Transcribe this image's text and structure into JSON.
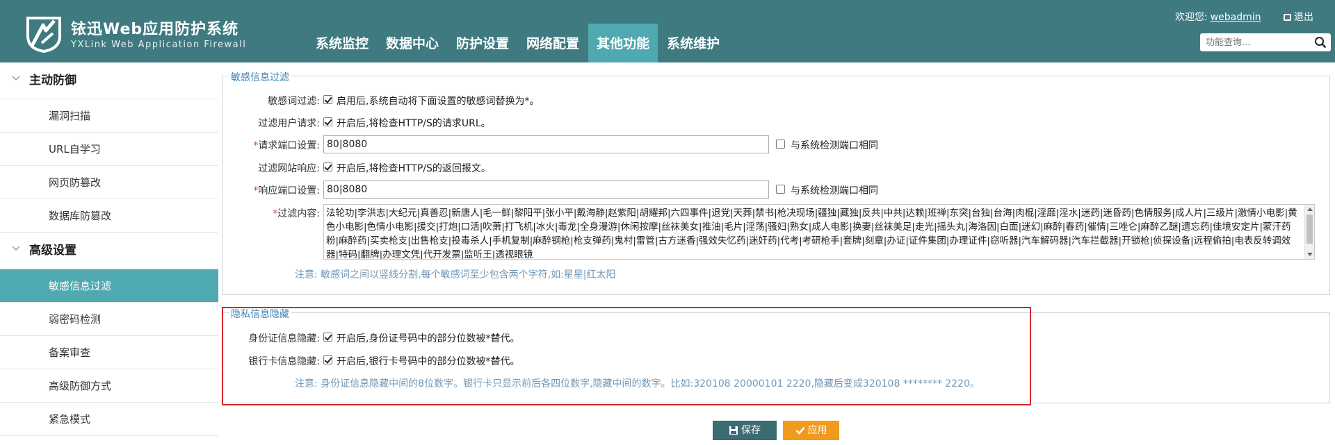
{
  "header": {
    "title": "铱迅Web应用防护系统",
    "subtitle": "YXLink Web Application Firewall",
    "nav": [
      "系统监控",
      "数据中心",
      "防护设置",
      "网络配置",
      "其他功能",
      "系统维护"
    ],
    "active_nav": "其他功能",
    "welcome_label": "欢迎您:",
    "username": "webadmin",
    "logout_label": "退出",
    "search_placeholder": "功能查询..."
  },
  "sidebar": {
    "groups": [
      {
        "label": "主动防御",
        "items": [
          "漏洞扫描",
          "URL自学习",
          "网页防篡改",
          "数据库防篡改"
        ]
      },
      {
        "label": "高级设置",
        "items": [
          "敏感信息过滤",
          "弱密码检测",
          "备案审查",
          "高级防御方式",
          "紧急模式"
        ]
      }
    ],
    "active_item": "敏感信息过滤"
  },
  "sensitive": {
    "legend": "敏感信息过滤",
    "word_filter_label": "敏感词过滤:",
    "word_filter_text": "启用后,系统自动将下面设置的敏感词替换为*。",
    "req_filter_label": "过滤用户请求:",
    "req_filter_text": "开启后,将检查HTTP/S的请求URL。",
    "req_port_label": "请求端口设置:",
    "req_port_value": "80|8080",
    "same_port_text": "与系统检测端口相同",
    "resp_filter_label": "过滤网站响应:",
    "resp_filter_text": "开启后,将检查HTTP/S的返回报文。",
    "resp_port_label": "响应端口设置:",
    "resp_port_value": "80|8080",
    "content_label": "过滤内容:",
    "content_value": "法轮功|李洪志|大纪元|真善忍|新唐人|毛一鲜|黎阳平|张小平|戴海静|赵紫阳|胡耀邦|六四事件|退党|天葬|禁书|枪决现场|疆独|藏独|反共|中共|达赖|班禅|东突|台独|台海|肉棍|淫靡|淫水|迷药|迷昏药|色情服务|成人片|三级片|激情小电影|黄色小电影|色情小电影|援交|打炮|口活|吹萧|打飞机|冰火|毒龙|全身漫游|休闲按摩|丝袜美女|推油|毛片|淫荡|骚妇|熟女|成人电影|换妻|丝袜美足|走光|摇头丸|海洛因|白面|迷幻|麻醉|春药|催情|三唑仑|麻醉乙醚|遗忘药|佳境安定片|蒙汗药粉|麻醉药|买卖枪支|出售枪支|投毒杀人|手机复制|麻醉钢枪|枪支弹药|鬼村|雷管|古方迷香|强效失忆药|迷奸药|代考|考研枪手|套牌|刻章|办证|证件集团|办理证件|窃听器|汽车解码器|汽车拦截器|开锁枪|侦探设备|远程偷拍|电表反转调效器|特码|翻牌|办理文凭|代开发票|监听王|透视眼镜",
    "note": "注意: 敏感词之间以竖线分割,每个敏感词至少包含两个字符,如:星星|红太阳"
  },
  "privacy": {
    "legend": "隐私信息隐藏",
    "id_label": "身份证信息隐藏:",
    "id_text": "开启后,身份证号码中的部分位数被*替代。",
    "bank_label": "银行卡信息隐藏:",
    "bank_text": "开启后,银行卡号码中的部分位数被*替代。",
    "note": "注意: 身份证信息隐藏中间的8位数字。银行卡只显示前后各四位数字,隐藏中间的数字。比如:320108 20000101 2220,隐藏后变成320108 ******** 2220。"
  },
  "buttons": {
    "save": "保存",
    "apply": "应用"
  },
  "colors": {
    "header": "#3f7a80",
    "accent": "#4fa9b0",
    "save": "#3c6c73",
    "apply": "#f19a1e",
    "highlight": "#d9252c"
  }
}
